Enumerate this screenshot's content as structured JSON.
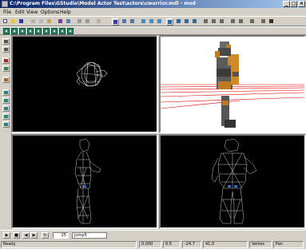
{
  "window": {
    "title": "C:\\Program Files\\GStudio\\Model Actor Test\\actors\\cwarrior.mdl - mod",
    "minimize": "_",
    "maximize": "□",
    "close": "×"
  },
  "menu": [
    "File",
    "Edit",
    "View",
    "Options",
    "Help"
  ],
  "toolbar": {
    "icons": [
      "new-icon",
      "open-icon",
      "save-icon",
      "cut-icon",
      "copy-icon",
      "paste-icon",
      "model-icon",
      "sequence-icon",
      "undo-icon",
      "redo-icon",
      "select-icon",
      "vertex-icon",
      "face-icon",
      "bone-icon",
      "pan-icon",
      "rotate-icon",
      "zoom-icon",
      "grid-icon",
      "view-icon",
      "wire-icon",
      "move-icon"
    ]
  },
  "animbar": {
    "frame": "25",
    "sequence": "jump5"
  },
  "status": {
    "ready": "Ready",
    "x": "0.000",
    "y": "0.5",
    "z": "-24.7",
    "w": "41.0",
    "mode": "Vertex",
    "tool": "Pan"
  },
  "colors": {
    "titlebar_start": "#0a246a",
    "titlebar_end": "#a6caf0",
    "face": "#d4d0c8",
    "viewport": "#000000",
    "wireframe": "#c8c8c8",
    "grid_red": "#e00000"
  }
}
